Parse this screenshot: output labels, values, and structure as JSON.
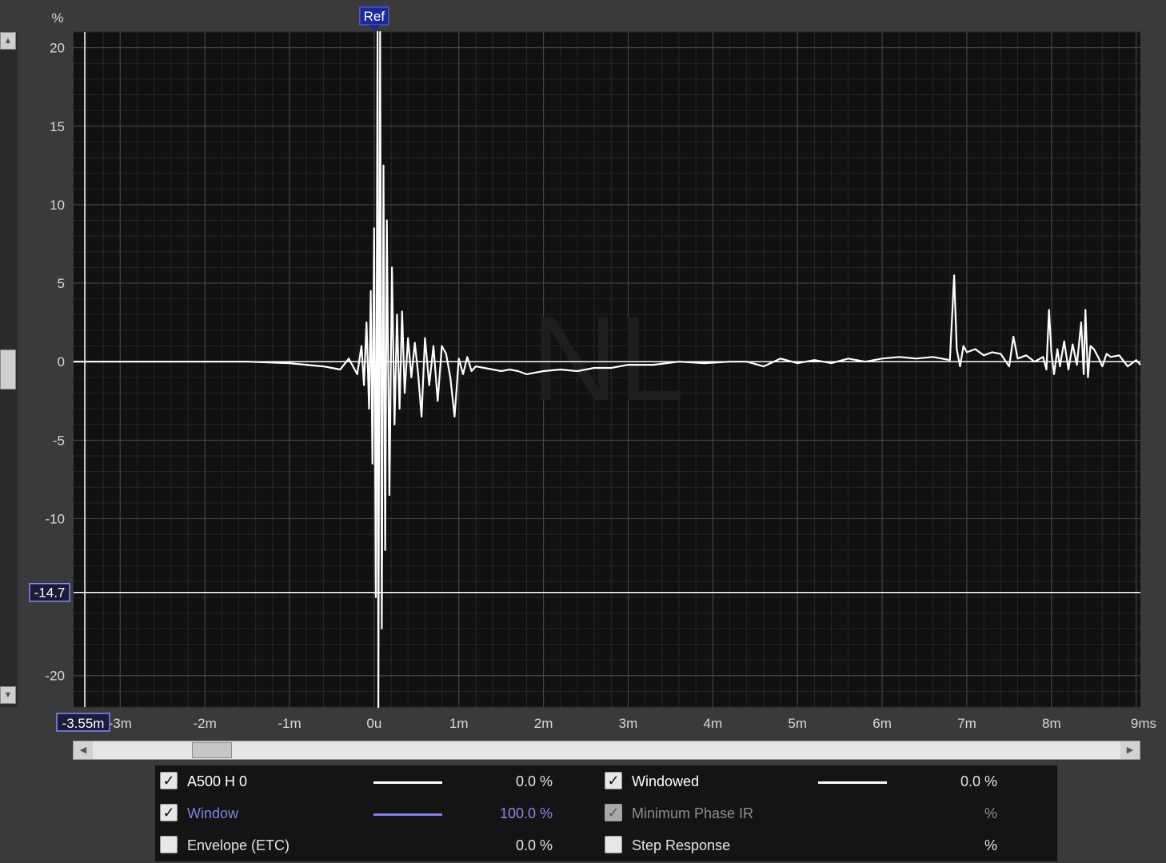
{
  "chart_data": {
    "type": "line",
    "ylabel": "%",
    "xunit": "ms",
    "xlim": [
      -3.55,
      9.05
    ],
    "ylim": [
      -22,
      21
    ],
    "yticks": [
      20,
      15,
      10,
      5,
      0,
      -5,
      -10,
      -20
    ],
    "xticks": [
      {
        "v": -3,
        "label": "-3m"
      },
      {
        "v": -2,
        "label": "-2m"
      },
      {
        "v": -1,
        "label": "-1m"
      },
      {
        "v": 0,
        "label": "0u"
      },
      {
        "v": 1,
        "label": "1m"
      },
      {
        "v": 2,
        "label": "2m"
      },
      {
        "v": 3,
        "label": "3m"
      },
      {
        "v": 4,
        "label": "4m"
      },
      {
        "v": 5,
        "label": "5m"
      },
      {
        "v": 6,
        "label": "6m"
      },
      {
        "v": 7,
        "label": "7m"
      },
      {
        "v": 8,
        "label": "8m"
      },
      {
        "v": 9,
        "label": "9ms"
      }
    ],
    "ref_marker": {
      "label": "Ref",
      "x": 0
    },
    "cursor": {
      "x": -3.55,
      "x_label": "-3.55m",
      "y": -14.7,
      "y_label": "-14.7"
    },
    "watermark": "NL",
    "grid": true,
    "series": [
      {
        "name": "A500 H 0",
        "color": "#ffffff",
        "x": [
          -3.55,
          -3.0,
          -2.5,
          -2.0,
          -1.5,
          -1.0,
          -0.8,
          -0.6,
          -0.5,
          -0.4,
          -0.3,
          -0.2,
          -0.15,
          -0.12,
          -0.09,
          -0.06,
          -0.04,
          -0.02,
          0.0,
          0.02,
          0.04,
          0.05,
          0.07,
          0.09,
          0.11,
          0.13,
          0.15,
          0.18,
          0.21,
          0.24,
          0.27,
          0.3,
          0.33,
          0.36,
          0.4,
          0.44,
          0.48,
          0.52,
          0.56,
          0.6,
          0.65,
          0.7,
          0.75,
          0.8,
          0.85,
          0.9,
          0.95,
          1.0,
          1.05,
          1.1,
          1.15,
          1.2,
          1.3,
          1.4,
          1.5,
          1.6,
          1.7,
          1.8,
          1.9,
          2.0,
          2.2,
          2.4,
          2.6,
          2.8,
          3.0,
          3.3,
          3.6,
          3.9,
          4.2,
          4.4,
          4.6,
          4.8,
          5.0,
          5.2,
          5.4,
          5.6,
          5.8,
          6.0,
          6.2,
          6.4,
          6.6,
          6.8,
          6.85,
          6.88,
          6.92,
          6.96,
          7.0,
          7.1,
          7.2,
          7.3,
          7.4,
          7.5,
          7.55,
          7.6,
          7.7,
          7.8,
          7.9,
          7.94,
          7.97,
          8.0,
          8.03,
          8.07,
          8.1,
          8.15,
          8.2,
          8.25,
          8.3,
          8.35,
          8.38,
          8.4,
          8.43,
          8.46,
          8.5,
          8.55,
          8.6,
          8.65,
          8.7,
          8.8,
          8.9,
          9.0,
          9.05
        ],
        "y": [
          0,
          0,
          0,
          0,
          0,
          -0.1,
          -0.2,
          -0.3,
          -0.4,
          -0.5,
          0.2,
          -0.8,
          1.0,
          -1.5,
          2.5,
          -3.0,
          4.5,
          -6.5,
          8.5,
          -15.0,
          21.0,
          -22.0,
          21.0,
          -17.0,
          12.5,
          -12.0,
          9.0,
          -8.5,
          6.0,
          -4.0,
          3.0,
          -3.0,
          3.2,
          -2.0,
          1.5,
          -1.0,
          1.2,
          -0.8,
          -3.5,
          1.5,
          -1.5,
          1.0,
          -2.5,
          1.0,
          0.5,
          -1.0,
          -3.5,
          0.2,
          -0.8,
          0.3,
          -0.6,
          -0.3,
          -0.4,
          -0.5,
          -0.6,
          -0.5,
          -0.6,
          -0.8,
          -0.7,
          -0.6,
          -0.5,
          -0.6,
          -0.4,
          -0.4,
          -0.2,
          -0.2,
          0,
          -0.1,
          0,
          0,
          -0.3,
          0.2,
          -0.1,
          0.1,
          -0.1,
          0.2,
          0,
          0.2,
          0.3,
          0.2,
          0.3,
          0.1,
          5.5,
          0.8,
          -0.3,
          1.0,
          0.6,
          0.8,
          0.4,
          0.6,
          0.5,
          -0.3,
          1.6,
          0.2,
          0.4,
          0.0,
          0.3,
          -0.5,
          3.3,
          0.5,
          -0.8,
          0.8,
          -0.3,
          1.3,
          -0.5,
          1.1,
          -0.2,
          2.5,
          -0.8,
          3.3,
          -1.0,
          1.0,
          0.8,
          0.3,
          -0.3,
          0.5,
          0.3,
          0.4,
          -0.3,
          0.1,
          -0.2
        ]
      }
    ],
    "windowed_series": {
      "x": [
        -3.55,
        9.05
      ],
      "y": [
        0,
        0
      ]
    }
  },
  "legend": [
    {
      "checked": true,
      "dim": false,
      "label": "A500 H 0",
      "color": "#ffffff",
      "has_line": true,
      "value": "0.0 %"
    },
    {
      "checked": true,
      "dim": false,
      "label": "Windowed",
      "color": "#ffffff",
      "has_line": true,
      "value": "0.0 %"
    },
    {
      "checked": true,
      "dim": false,
      "label": "Window",
      "color": "#8080e8",
      "has_line": true,
      "value": "100.0 %"
    },
    {
      "checked": true,
      "dim": true,
      "label": "Minimum Phase IR",
      "color": "#8d8d8d",
      "has_line": false,
      "value": "%"
    },
    {
      "checked": false,
      "dim": false,
      "label": "Envelope (ETC)",
      "color": "#e4e4e4",
      "has_line": false,
      "value": "0.0 %"
    },
    {
      "checked": false,
      "dim": false,
      "label": "Step Response",
      "color": "#e4e4e4",
      "has_line": false,
      "value": "%"
    }
  ],
  "scrollbars": {
    "horizontal_position": 0.1,
    "vertical_position": 0.5
  }
}
